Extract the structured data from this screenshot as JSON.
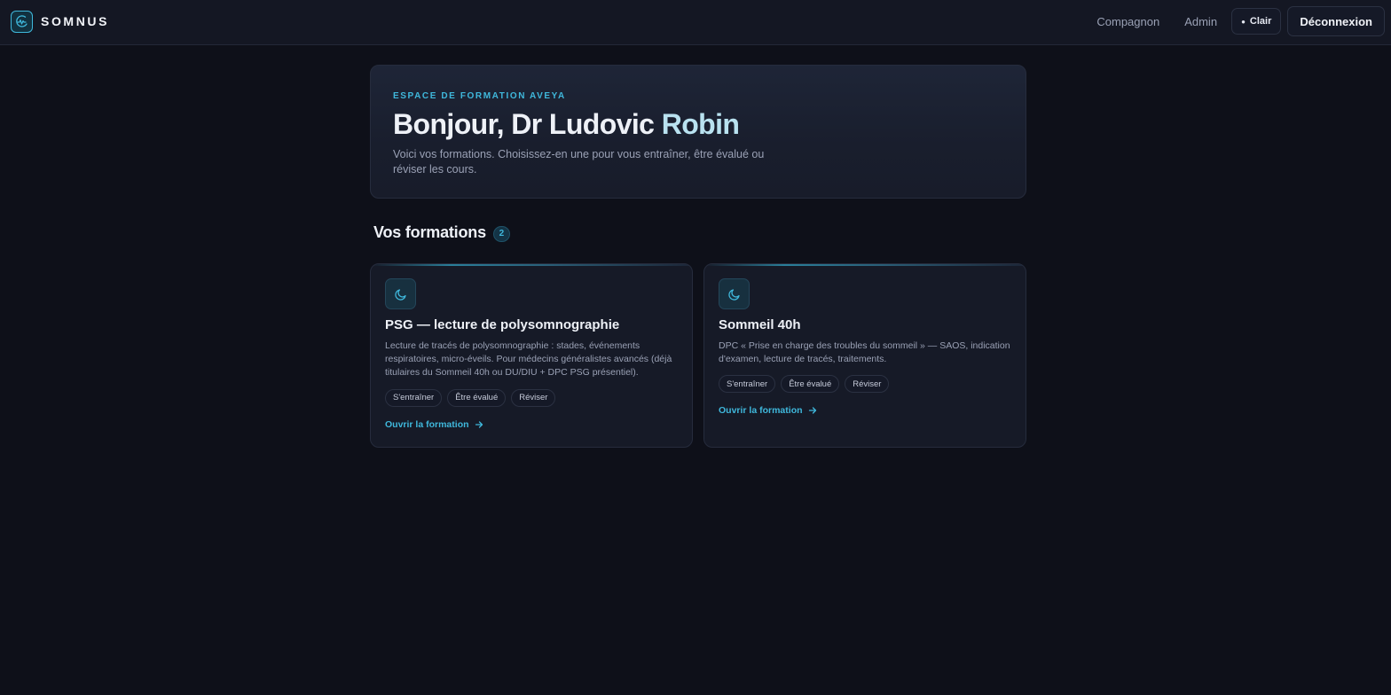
{
  "header": {
    "brand": "SOMNUS",
    "nav": {
      "companion": "Compagnon",
      "admin": "Admin",
      "theme_label": "Clair",
      "logout": "Déconnexion"
    }
  },
  "hero": {
    "eyebrow": "ESPACE DE FORMATION AVEYA",
    "greeting": "Bonjour, Dr Ludovic",
    "name_accent": "Robin",
    "subtitle": "Voici vos formations. Choisissez-en une pour vous entraîner, être évalué ou réviser les cours."
  },
  "section": {
    "title": "Vos formations",
    "count": "2"
  },
  "courses": [
    {
      "icon": "moon-icon",
      "title": "PSG — lecture de polysomnographie",
      "description": "Lecture de tracés de polysomnographie : stades, événements respiratoires, micro-éveils. Pour médecins généralistes avancés (déjà titulaires du Sommeil 40h ou DU/DIU + DPC PSG présentiel).",
      "tags": [
        "S'entraîner",
        "Être évalué",
        "Réviser"
      ],
      "link": "Ouvrir la formation"
    },
    {
      "icon": "moon-icon",
      "title": "Sommeil 40h",
      "description": "DPC « Prise en charge des troubles du sommeil » — SAOS, indication d'examen, lecture de tracés, traitements.",
      "tags": [
        "S'entraîner",
        "Être évalué",
        "Réviser"
      ],
      "link": "Ouvrir la formation"
    }
  ],
  "colors": {
    "accent": "#3fb8dc",
    "background": "#0e1019",
    "card": "#161a27"
  }
}
